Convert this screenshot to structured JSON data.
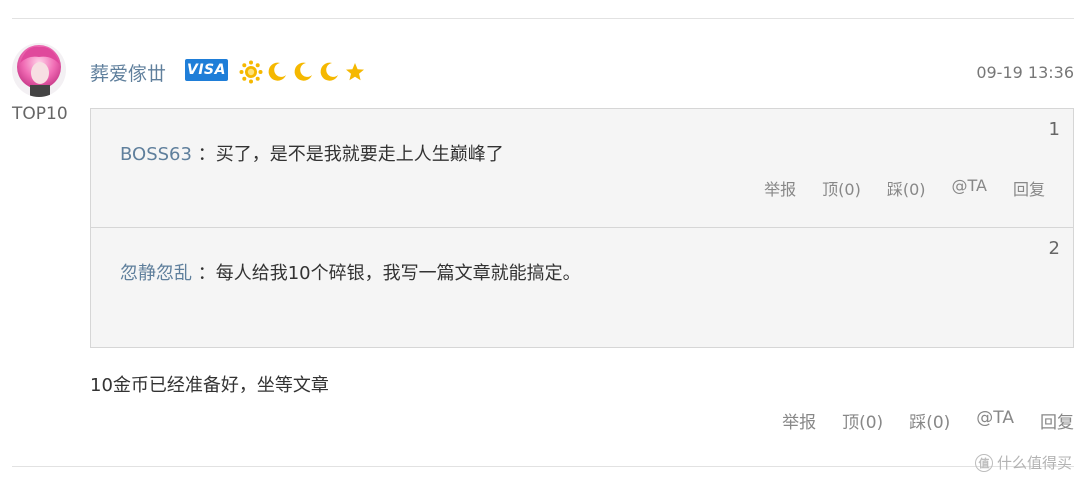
{
  "comment": {
    "username": "葬爱傢丗",
    "badge_text": "VISA",
    "rank": "TOP10",
    "timestamp": "09-19 13:36",
    "level_icons": [
      "sun-icon",
      "moon-icon",
      "moon-icon",
      "moon-icon",
      "star-icon"
    ],
    "quotes": [
      {
        "floor": "1",
        "author": "BOSS63",
        "separator": " ：",
        "text": "买了，是不是我就要走上人生巅峰了"
      },
      {
        "floor": "2",
        "author": "忽静忽乱",
        "separator": " ：",
        "text": "每人给我10个碎银，我写一篇文章就能搞定。"
      }
    ],
    "text": "10金币已经准备好，坐等文章"
  },
  "actions": {
    "report": "举报",
    "upvote": "顶(0)",
    "downvote": "踩(0)",
    "mention": "@TA",
    "reply": "回复"
  },
  "watermark": {
    "icon_text": "值",
    "text": "什么值得买"
  },
  "colors": {
    "username": "#5f7f9c",
    "badge": "#1f7ed8",
    "level_icon": "#f5b800",
    "quote_bg": "#f5f5f5",
    "border": "#d6d6d6"
  }
}
